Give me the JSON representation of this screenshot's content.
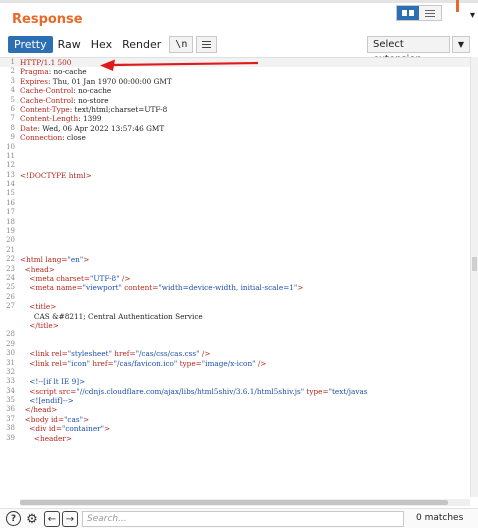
{
  "panel": {
    "title": "Response"
  },
  "layout_toggle": {
    "active": "split"
  },
  "tabs": [
    {
      "label": "Pretty",
      "active": true
    },
    {
      "label": "Raw",
      "active": false
    },
    {
      "label": "Hex",
      "active": false
    },
    {
      "label": "Render",
      "active": false
    }
  ],
  "toolbar": {
    "newline_label": "\\n",
    "extension_select": "Select extension..."
  },
  "lines": [
    {
      "n": "1",
      "segs": [
        [
          "k",
          "HTTP/1.1 500"
        ]
      ]
    },
    {
      "n": "2",
      "segs": [
        [
          "k",
          "Pragma"
        ],
        [
          "t",
          ": no-cache"
        ]
      ]
    },
    {
      "n": "3",
      "segs": [
        [
          "k",
          "Expires"
        ],
        [
          "t",
          ": Thu, 01 Jan 1970 00:00:00 GMT"
        ]
      ]
    },
    {
      "n": "4",
      "segs": [
        [
          "k",
          "Cache-Control"
        ],
        [
          "t",
          ": no-cache"
        ]
      ]
    },
    {
      "n": "5",
      "segs": [
        [
          "k",
          "Cache-Control"
        ],
        [
          "t",
          ": no-store"
        ]
      ]
    },
    {
      "n": "6",
      "segs": [
        [
          "k",
          "Content-Type"
        ],
        [
          "t",
          ": text/html;charset=UTF-8"
        ]
      ]
    },
    {
      "n": "7",
      "segs": [
        [
          "k",
          "Content-Length"
        ],
        [
          "t",
          ": 1399"
        ]
      ]
    },
    {
      "n": "8",
      "segs": [
        [
          "k",
          "Date"
        ],
        [
          "t",
          ": Wed, 06 Apr 2022 13:57:46 GMT"
        ]
      ]
    },
    {
      "n": "9",
      "segs": [
        [
          "k",
          "Connection"
        ],
        [
          "t",
          ": close"
        ]
      ]
    },
    {
      "n": "10",
      "segs": []
    },
    {
      "n": "11",
      "segs": []
    },
    {
      "n": "12",
      "segs": []
    },
    {
      "n": "13",
      "segs": [
        [
          "g",
          "<!DOCTYPE html>"
        ]
      ]
    },
    {
      "n": "14",
      "segs": []
    },
    {
      "n": "15",
      "segs": []
    },
    {
      "n": "16",
      "segs": []
    },
    {
      "n": "17",
      "segs": []
    },
    {
      "n": "18",
      "segs": []
    },
    {
      "n": "19",
      "segs": []
    },
    {
      "n": "20",
      "segs": []
    },
    {
      "n": "21",
      "segs": []
    },
    {
      "n": "22",
      "segs": [
        [
          "g",
          "<html "
        ],
        [
          "a",
          "lang="
        ],
        [
          "v",
          "\"en\""
        ],
        [
          "g",
          ">"
        ]
      ]
    },
    {
      "n": "23",
      "segs": [
        [
          "t",
          "  "
        ],
        [
          "g",
          "<head>"
        ]
      ]
    },
    {
      "n": "24",
      "segs": [
        [
          "t",
          "    "
        ],
        [
          "g",
          "<meta "
        ],
        [
          "a",
          "charset="
        ],
        [
          "v",
          "\"UTF-8\""
        ],
        [
          "g",
          " />"
        ]
      ]
    },
    {
      "n": "25",
      "segs": [
        [
          "t",
          "    "
        ],
        [
          "g",
          "<meta "
        ],
        [
          "a",
          "name="
        ],
        [
          "v",
          "\"viewport\""
        ],
        [
          "a",
          " content="
        ],
        [
          "v",
          "\"width=device-width, initial-scale=1\""
        ],
        [
          "g",
          ">"
        ]
      ]
    },
    {
      "n": "26",
      "segs": []
    },
    {
      "n": "27",
      "segs": [
        [
          "t",
          "    "
        ],
        [
          "g",
          "<title>"
        ]
      ]
    },
    {
      "n": "",
      "segs": [
        [
          "t",
          "      CAS &#8211; Central Authentication Service"
        ]
      ]
    },
    {
      "n": "",
      "segs": [
        [
          "t",
          "    "
        ],
        [
          "g",
          "</title>"
        ]
      ]
    },
    {
      "n": "28",
      "segs": []
    },
    {
      "n": "29",
      "segs": []
    },
    {
      "n": "30",
      "segs": [
        [
          "t",
          "    "
        ],
        [
          "g",
          "<link "
        ],
        [
          "a",
          "rel="
        ],
        [
          "v",
          "\"stylesheet\""
        ],
        [
          "a",
          " href="
        ],
        [
          "v",
          "\"/cas/css/cas.css\""
        ],
        [
          "g",
          " />"
        ]
      ]
    },
    {
      "n": "31",
      "segs": [
        [
          "t",
          "    "
        ],
        [
          "g",
          "<link "
        ],
        [
          "a",
          "rel="
        ],
        [
          "v",
          "\"icon\""
        ],
        [
          "a",
          " href="
        ],
        [
          "v",
          "\"/cas/favicon.ico\""
        ],
        [
          "a",
          " type="
        ],
        [
          "v",
          "\"image/x-icon\""
        ],
        [
          "g",
          " />"
        ]
      ]
    },
    {
      "n": "32",
      "segs": []
    },
    {
      "n": "33",
      "segs": [
        [
          "t",
          "    "
        ],
        [
          "c",
          "<!--[if lt IE 9]>"
        ]
      ]
    },
    {
      "n": "34",
      "segs": [
        [
          "t",
          "    "
        ],
        [
          "g",
          "<script "
        ],
        [
          "a",
          "src="
        ],
        [
          "v",
          "\"//cdnjs.cloudflare.com/ajax/libs/html5shiv/3.6.1/html5shiv.js\""
        ],
        [
          "a",
          " type="
        ],
        [
          "v",
          "\"text/javas"
        ]
      ]
    },
    {
      "n": "35",
      "segs": [
        [
          "t",
          "    "
        ],
        [
          "c",
          "<![endif]-->"
        ]
      ]
    },
    {
      "n": "36",
      "segs": [
        [
          "t",
          "  "
        ],
        [
          "g",
          "</head>"
        ]
      ]
    },
    {
      "n": "37",
      "segs": [
        [
          "t",
          "  "
        ],
        [
          "g",
          "<body "
        ],
        [
          "a",
          "id="
        ],
        [
          "v",
          "\"cas\""
        ],
        [
          "g",
          ">"
        ]
      ]
    },
    {
      "n": "38",
      "segs": [
        [
          "t",
          "    "
        ],
        [
          "g",
          "<div "
        ],
        [
          "a",
          "id="
        ],
        [
          "v",
          "\"container\""
        ],
        [
          "g",
          ">"
        ]
      ]
    },
    {
      "n": "39",
      "segs": [
        [
          "t",
          "      "
        ],
        [
          "g",
          "<header>"
        ]
      ]
    }
  ],
  "search": {
    "placeholder": "Search...",
    "value": "",
    "matches": "0 matches"
  },
  "colors": {
    "accent": "#e8692a",
    "tab_active": "#2d6fb3",
    "annotation_arrow": "#e01a1a",
    "syntax_red": "#b3261e",
    "syntax_blue": "#1b50a8"
  },
  "icons": [
    "help-icon",
    "settings-icon",
    "previous-arrow-icon",
    "next-arrow-icon",
    "split-view-icon",
    "rows-view-icon",
    "hamburger-menu-icon",
    "chevron-down-icon"
  ]
}
